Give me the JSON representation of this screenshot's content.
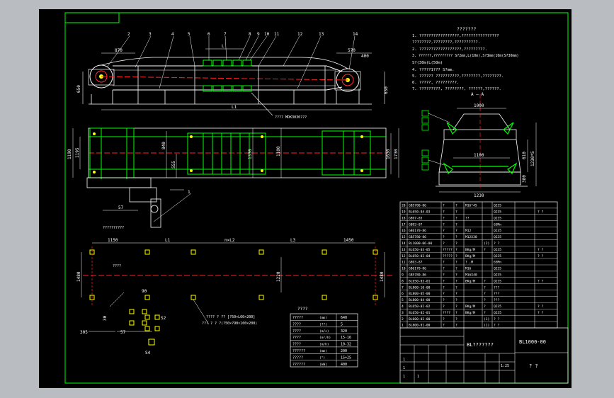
{
  "tech_notes": {
    "title": "???????",
    "lines": [
      "1. ?????????????????,????????????????",
      "   ????????,????????,??????????.",
      "2. ??????????????????,?????????.",
      "3. ??????,?????????    S?2mm,L(10m),S?3mm(10m(S?30mm)",
      "   S?(30m(L(50m)",
      "4. ?????1???          S?mm.",
      "5. ??????  ??????????,????????,????????.",
      "6. ?????, ?????????.",
      "7. ?????????, ????????, ??????,??????."
    ]
  },
  "section_label": "A — A",
  "main_view_labels": {
    "part_numbers": [
      "2",
      "3",
      "4",
      "5",
      "6",
      "7",
      "8",
      "9",
      "10",
      "11",
      "12",
      "13",
      "14"
    ],
    "dim_870": "870",
    "dim_570": "570",
    "dim_400": "400",
    "dim_L": "L",
    "dim_L1": "L1",
    "dim_650_left": "650",
    "dim_650_right": "650",
    "chain_note": "???? MDK3030???",
    "foundation_note": "??????????"
  },
  "plan_view_dims": [
    "1190",
    "1195",
    "840",
    "555",
    "1330",
    "1100",
    "1630",
    "1730",
    "57",
    "1"
  ],
  "foundation_dims": [
    "1150",
    "L1",
    "n×L2",
    "L3",
    "1450",
    "1480",
    "1220",
    "1480",
    "????",
    "305",
    "57",
    "90",
    "30",
    "S4",
    "S2"
  ],
  "anchor_note_1": "???? ?  ?? [?50×L60×200]",
  "anchor_note_2": "??? ? ? ?(?50×?90×100×200)",
  "section_dims": [
    "1000",
    "1100",
    "1230",
    "610",
    "1230*5",
    "380"
  ],
  "param_table": {
    "title": "????",
    "rows": [
      {
        "name": "?????",
        "unit": "(mm)",
        "value": "640"
      },
      {
        "name": "????",
        "unit": "(??)",
        "value": "5"
      },
      {
        "name": "????",
        "unit": "(m/s)",
        "value": "320"
      },
      {
        "name": "????",
        "unit": "(m³/h)",
        "value": "15-16"
      },
      {
        "name": "????",
        "unit": "(m/h)",
        "value": "10-32"
      },
      {
        "name": "??????",
        "unit": "(mm)",
        "value": "200"
      },
      {
        "name": "?????",
        "unit": "(°)",
        "value": "15+25"
      },
      {
        "name": "??????",
        "unit": "(kW)",
        "value": "400"
      }
    ]
  },
  "parts_list": [
    [
      "20",
      "GB5780-86",
      "?",
      "?",
      "M16*45",
      "",
      "Q235",
      "",
      ""
    ],
    [
      "19",
      "BL650-04-03",
      "?",
      "?",
      "",
      "",
      "Q235",
      "",
      "? ?"
    ],
    [
      "18",
      "GB97-85",
      "?",
      "?",
      "??",
      "",
      "Q235",
      "",
      ""
    ],
    [
      "17",
      "GB93-87",
      "?",
      "?",
      "",
      "",
      "65Mn",
      "",
      ""
    ],
    [
      "16",
      "GB6170-86",
      "?",
      "?",
      "M12",
      "",
      "Q235",
      "",
      ""
    ],
    [
      "15",
      "GB5780-86",
      "?",
      "?",
      "M12X30",
      "",
      "Q235",
      "",
      ""
    ],
    [
      "14",
      "BL1000-06-00",
      "?",
      "?",
      "",
      "(2)",
      "? ?",
      "",
      ""
    ],
    [
      "13",
      "BL650-03-05",
      "?????",
      "?",
      "BKg/M",
      "?",
      "Q235",
      "",
      "? ?"
    ],
    [
      "12",
      "BL650-03-04",
      "?????",
      "?",
      "BKg/M",
      "",
      "Q235",
      "",
      "? ?"
    ],
    [
      "11",
      "GB93-87",
      "?",
      "?",
      "?  ,M",
      "",
      "65Mn",
      "",
      ""
    ],
    [
      "10",
      "GB6170-86",
      "?",
      "?",
      "M16",
      "",
      "Q235",
      "",
      ""
    ],
    [
      "9",
      "GB5780-86",
      "?",
      "?",
      "M16X40",
      "",
      "Q235",
      "",
      ""
    ],
    [
      "8",
      "BL650-03-01",
      "?",
      "?",
      "BKg/M",
      "?",
      "Q235",
      "",
      "? ?"
    ],
    [
      "7",
      "BL800-10-00",
      "?",
      "?",
      "",
      "?",
      "???",
      "",
      ""
    ],
    [
      "6",
      "BL800-05-00",
      "?",
      "?",
      "",
      "?",
      "???",
      "",
      ""
    ],
    [
      "5",
      "BL800-04-00",
      "?",
      "?",
      "",
      "?",
      "???",
      "",
      ""
    ],
    [
      "4",
      "BL650-02-02",
      "?",
      "?",
      "BKg/M",
      "?",
      "Q235",
      "",
      "? ?"
    ],
    [
      "3",
      "BL650-02-01",
      "????",
      "?",
      "BKg/M",
      "?",
      "Q235",
      "",
      "? ?"
    ],
    [
      "2",
      "BL600-02-00",
      "?",
      "?",
      "",
      "(1)",
      "? ?",
      "",
      ""
    ],
    [
      "1",
      "BL800-01-00",
      "?",
      "?",
      "",
      "(1)",
      "? ?",
      "",
      ""
    ]
  ],
  "title_block": {
    "drawing_name": "BL???????",
    "drawing_number": "BL1000-00",
    "scale_label": "? ?",
    "company": "",
    "misc_cells": [
      "1:25",
      "1",
      "1",
      "1",
      "1"
    ]
  },
  "colors": {
    "background": "#000000",
    "frame": "#00ff00",
    "lines": "#ffffff",
    "centerline": "#ff0000",
    "highlight": "#ffff00",
    "dims": "#00ffff"
  }
}
